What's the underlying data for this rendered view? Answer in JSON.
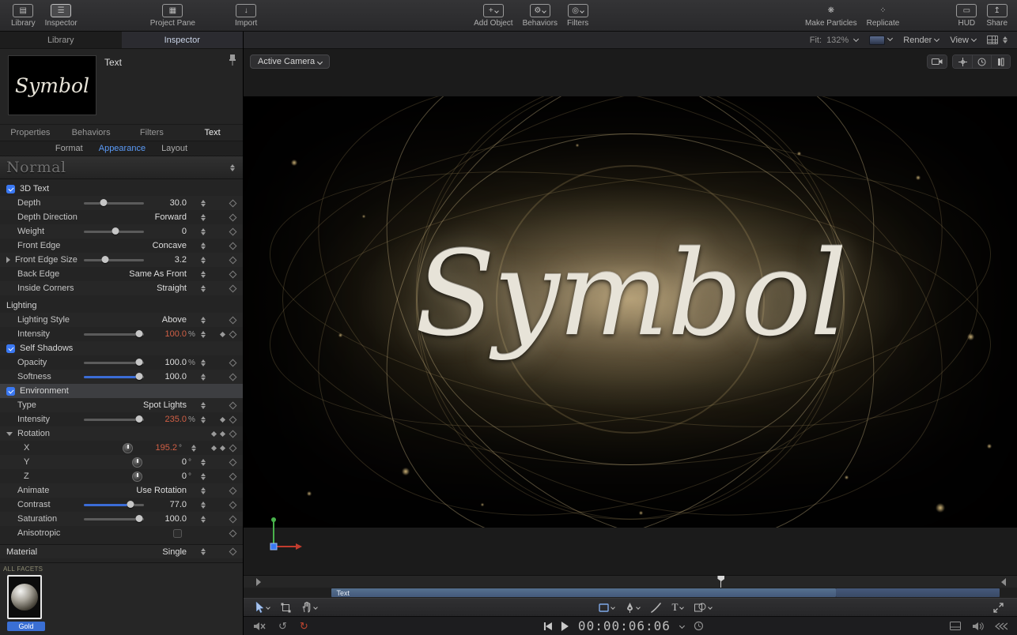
{
  "toolbar": {
    "library": "Library",
    "inspector": "Inspector",
    "project_pane": "Project Pane",
    "import": "Import",
    "add_object": "Add Object",
    "behaviors": "Behaviors",
    "filters": "Filters",
    "make_particles": "Make Particles",
    "replicate": "Replicate",
    "hud": "HUD",
    "share": "Share"
  },
  "panel": {
    "tab_library": "Library",
    "tab_inspector": "Inspector",
    "preview_title": "Text",
    "preview_text": "Symbol",
    "tabs": {
      "properties": "Properties",
      "behaviors": "Behaviors",
      "filters": "Filters",
      "text": "Text"
    },
    "subtabs": {
      "format": "Format",
      "appearance": "Appearance",
      "layout": "Layout"
    },
    "preset": "Normal",
    "rows": [
      {
        "label": "3D Text",
        "checked": true
      },
      {
        "label": "Depth",
        "value": "30.0"
      },
      {
        "label": "Depth Direction",
        "value": "Forward"
      },
      {
        "label": "Weight",
        "value": "0"
      },
      {
        "label": "Front Edge",
        "value": "Concave"
      },
      {
        "label": "Front Edge Size",
        "value": "3.2"
      },
      {
        "label": "Back Edge",
        "value": "Same As Front"
      },
      {
        "label": "Inside Corners",
        "value": "Straight"
      },
      {
        "label": "Lighting"
      },
      {
        "label": "Lighting Style",
        "value": "Above"
      },
      {
        "label": "Intensity",
        "value": "100.0",
        "unit": "%"
      },
      {
        "label": "Self Shadows",
        "checked": true
      },
      {
        "label": "Opacity",
        "value": "100.0",
        "unit": "%"
      },
      {
        "label": "Softness",
        "value": "100.0"
      },
      {
        "label": "Environment",
        "checked": true
      },
      {
        "label": "Type",
        "value": "Spot Lights"
      },
      {
        "label": "Intensity",
        "value": "235.0",
        "unit": "%"
      },
      {
        "label": "Rotation"
      },
      {
        "label": "X",
        "value": "195.2",
        "unit": "°"
      },
      {
        "label": "Y",
        "value": "0",
        "unit": "°"
      },
      {
        "label": "Z",
        "value": "0",
        "unit": "°"
      },
      {
        "label": "Animate",
        "value": "Use Rotation"
      },
      {
        "label": "Contrast",
        "value": "77.0"
      },
      {
        "label": "Saturation",
        "value": "100.0"
      },
      {
        "label": "Anisotropic",
        "checked": false
      },
      {
        "label": "Material",
        "value": "Single"
      }
    ],
    "material": {
      "facets": "ALL FACETS",
      "name": "Gold"
    }
  },
  "canvas": {
    "camera_menu": "Active Camera",
    "fit_label": "Fit:",
    "fit_value": "132%",
    "render": "Render",
    "view": "View",
    "text": "Symbol"
  },
  "timeline": {
    "track_label": "Text"
  },
  "transport": {
    "timecode": "00:00:06:06"
  }
}
